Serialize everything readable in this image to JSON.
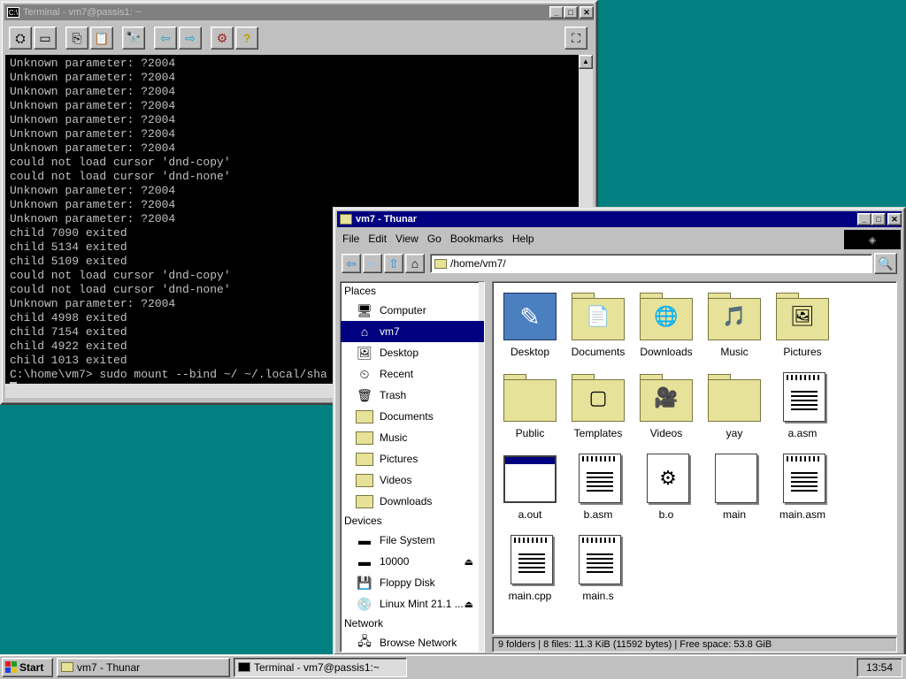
{
  "terminal": {
    "title": "Terminal - vm7@passis1: ~",
    "lines": [
      "Unknown parameter: ?2004",
      "Unknown parameter: ?2004",
      "Unknown parameter: ?2004",
      "Unknown parameter: ?2004",
      "Unknown parameter: ?2004",
      "Unknown parameter: ?2004",
      "Unknown parameter: ?2004",
      "could not load cursor 'dnd-copy'",
      "could not load cursor 'dnd-none'",
      "Unknown parameter: ?2004",
      "Unknown parameter: ?2004",
      "Unknown parameter: ?2004",
      "child 7090 exited",
      "child 5134 exited",
      "child 5109 exited",
      "could not load cursor 'dnd-copy'",
      "could not load cursor 'dnd-none'",
      "Unknown parameter: ?2004",
      "child 4998 exited",
      "child 7154 exited",
      "child 4922 exited",
      "child 1013 exited"
    ],
    "prompt": "C:\\home\\vm7> sudo mount --bind ~/ ~/.local/sha"
  },
  "thunar": {
    "title": "vm7 - Thunar",
    "menu": [
      "File",
      "Edit",
      "View",
      "Go",
      "Bookmarks",
      "Help"
    ],
    "path": "/home/vm7/",
    "places_heading": "Places",
    "places": [
      {
        "label": "Computer",
        "icon": "computer-icon"
      },
      {
        "label": "vm7",
        "icon": "home-icon",
        "selected": true
      },
      {
        "label": "Desktop",
        "icon": "desktop-icon"
      },
      {
        "label": "Recent",
        "icon": "recent-icon"
      },
      {
        "label": "Trash",
        "icon": "trash-icon"
      },
      {
        "label": "Documents",
        "icon": "folder-icon"
      },
      {
        "label": "Music",
        "icon": "folder-icon"
      },
      {
        "label": "Pictures",
        "icon": "folder-icon"
      },
      {
        "label": "Videos",
        "icon": "folder-icon"
      },
      {
        "label": "Downloads",
        "icon": "folder-icon"
      }
    ],
    "devices_heading": "Devices",
    "devices": [
      {
        "label": "File System",
        "icon": "drive-icon"
      },
      {
        "label": "10000",
        "icon": "drive-icon",
        "eject": true
      },
      {
        "label": "Floppy Disk",
        "icon": "floppy-icon"
      },
      {
        "label": "Linux Mint 21.1 ...",
        "icon": "cdrom-icon",
        "eject": true
      }
    ],
    "network_heading": "Network",
    "network": [
      {
        "label": "Browse Network",
        "icon": "network-icon"
      }
    ],
    "files": [
      {
        "label": "Desktop",
        "kind": "desktop"
      },
      {
        "label": "Documents",
        "kind": "folder",
        "glyph": "📄"
      },
      {
        "label": "Downloads",
        "kind": "folder",
        "glyph": "🌐"
      },
      {
        "label": "Music",
        "kind": "folder",
        "glyph": "🎵"
      },
      {
        "label": "Pictures",
        "kind": "folder",
        "glyph": "🖼"
      },
      {
        "label": "Public",
        "kind": "folder",
        "glyph": ""
      },
      {
        "label": "Templates",
        "kind": "folder",
        "glyph": "▢"
      },
      {
        "label": "Videos",
        "kind": "folder",
        "glyph": "🎥"
      },
      {
        "label": "yay",
        "kind": "folder",
        "glyph": ""
      },
      {
        "label": "a.asm",
        "kind": "text"
      },
      {
        "label": "a.out",
        "kind": "exec"
      },
      {
        "label": "b.asm",
        "kind": "text"
      },
      {
        "label": "b.o",
        "kind": "object"
      },
      {
        "label": "main",
        "kind": "blank"
      },
      {
        "label": "main.asm",
        "kind": "text"
      },
      {
        "label": "main.cpp",
        "kind": "text"
      },
      {
        "label": "main.s",
        "kind": "text"
      }
    ],
    "status": "9 folders  |  8 files: 11.3 KiB (11592 bytes)  |  Free space: 53.8 GiB"
  },
  "taskbar": {
    "start": "Start",
    "tasks": [
      {
        "label": "vm7 - Thunar",
        "pressed": false
      },
      {
        "label": "Terminal - vm7@passis1:~",
        "pressed": true
      }
    ],
    "clock": "13:54"
  }
}
